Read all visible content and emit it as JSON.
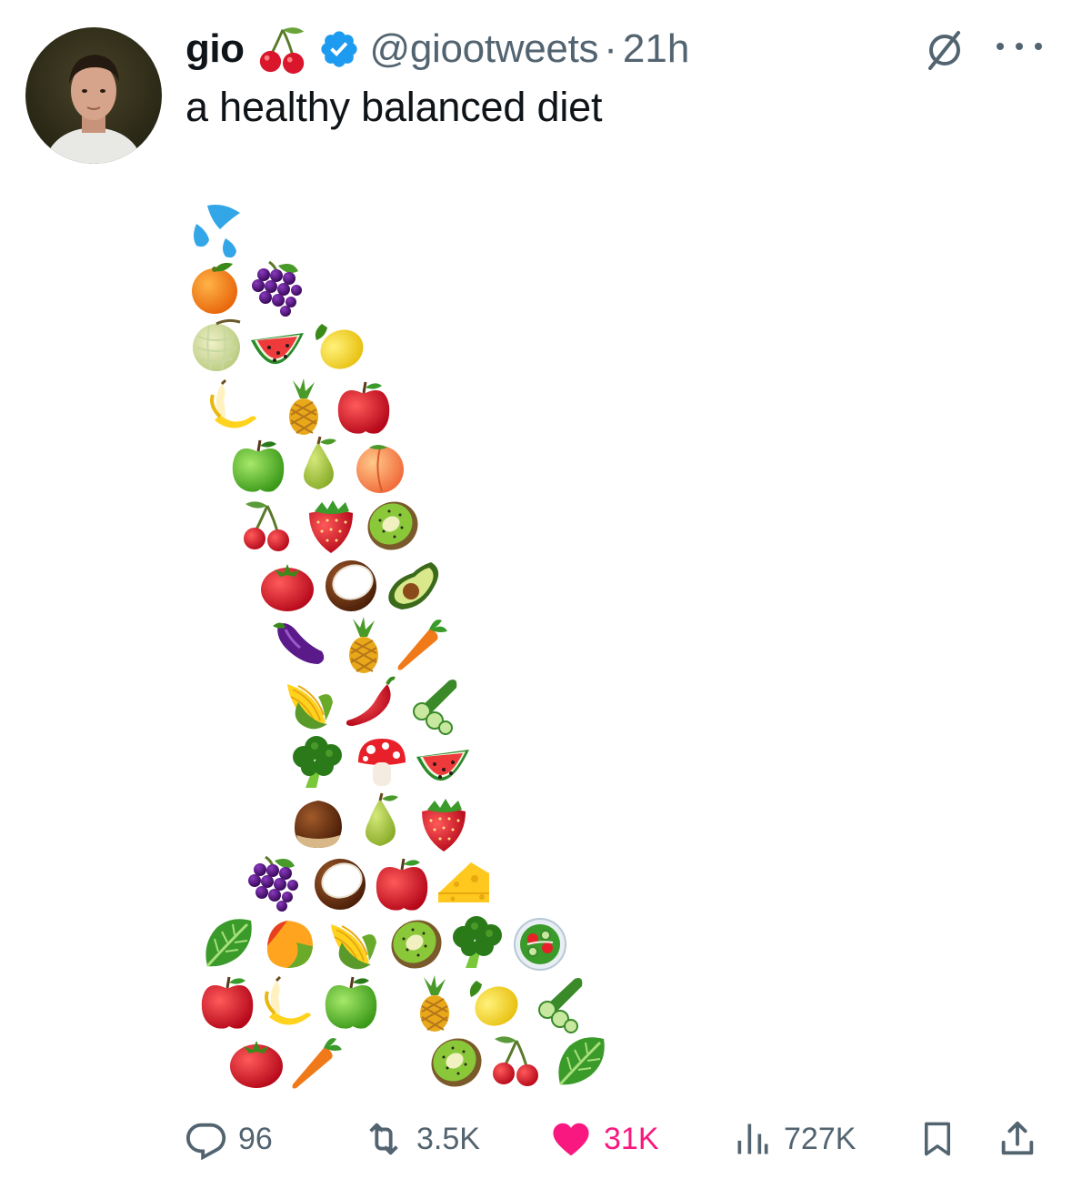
{
  "tweet": {
    "display_name": "gio",
    "handle": "@giootweets",
    "separator": "·",
    "time": "21h",
    "text": "a healthy balanced diet"
  },
  "stats": {
    "replies": "96",
    "reposts": "3.5K",
    "likes": "31K",
    "views": "727K"
  },
  "icons": {
    "badge_emoji": "cherries-icon",
    "verified": "verified-badge-icon",
    "grok": "grok-icon",
    "more": "more-icon",
    "reply": "reply-icon",
    "repost": "repost-icon",
    "like": "heart-icon",
    "views": "views-icon",
    "bookmark": "bookmark-icon",
    "share": "share-icon"
  },
  "colors": {
    "text": "#0f1419",
    "secondary": "#536471",
    "verified": "#1d9bf0",
    "like": "#f91880"
  },
  "emoji_rows": [
    [
      "sweat-droplets"
    ],
    [
      "tangerine",
      "grapes"
    ],
    [
      "melon",
      "watermelon",
      "lemon"
    ],
    [
      "banana",
      "pineapple",
      "red-apple"
    ],
    [
      "green-apple",
      "pear",
      "peach"
    ],
    [
      "cherries",
      "strawberry",
      "kiwi"
    ],
    [
      "tomato",
      "coconut",
      "avocado"
    ],
    [
      "eggplant",
      "pineapple",
      "carrot"
    ],
    [
      "corn",
      "hot-pepper",
      "cucumber"
    ],
    [
      "broccoli",
      "mushroom",
      "watermelon"
    ],
    [
      "chestnut",
      "pear",
      "strawberry"
    ],
    [
      "grapes",
      "coconut",
      "red-apple",
      "cheese"
    ],
    [
      "leafy-green",
      "mango",
      "corn",
      "kiwi",
      "broccoli",
      "salad"
    ],
    [
      "red-apple",
      "banana",
      "green-apple",
      "pineapple",
      "lemon",
      "cucumber"
    ],
    [
      "tomato",
      "carrot",
      "kiwi",
      "cherries",
      "leafy-green"
    ]
  ]
}
